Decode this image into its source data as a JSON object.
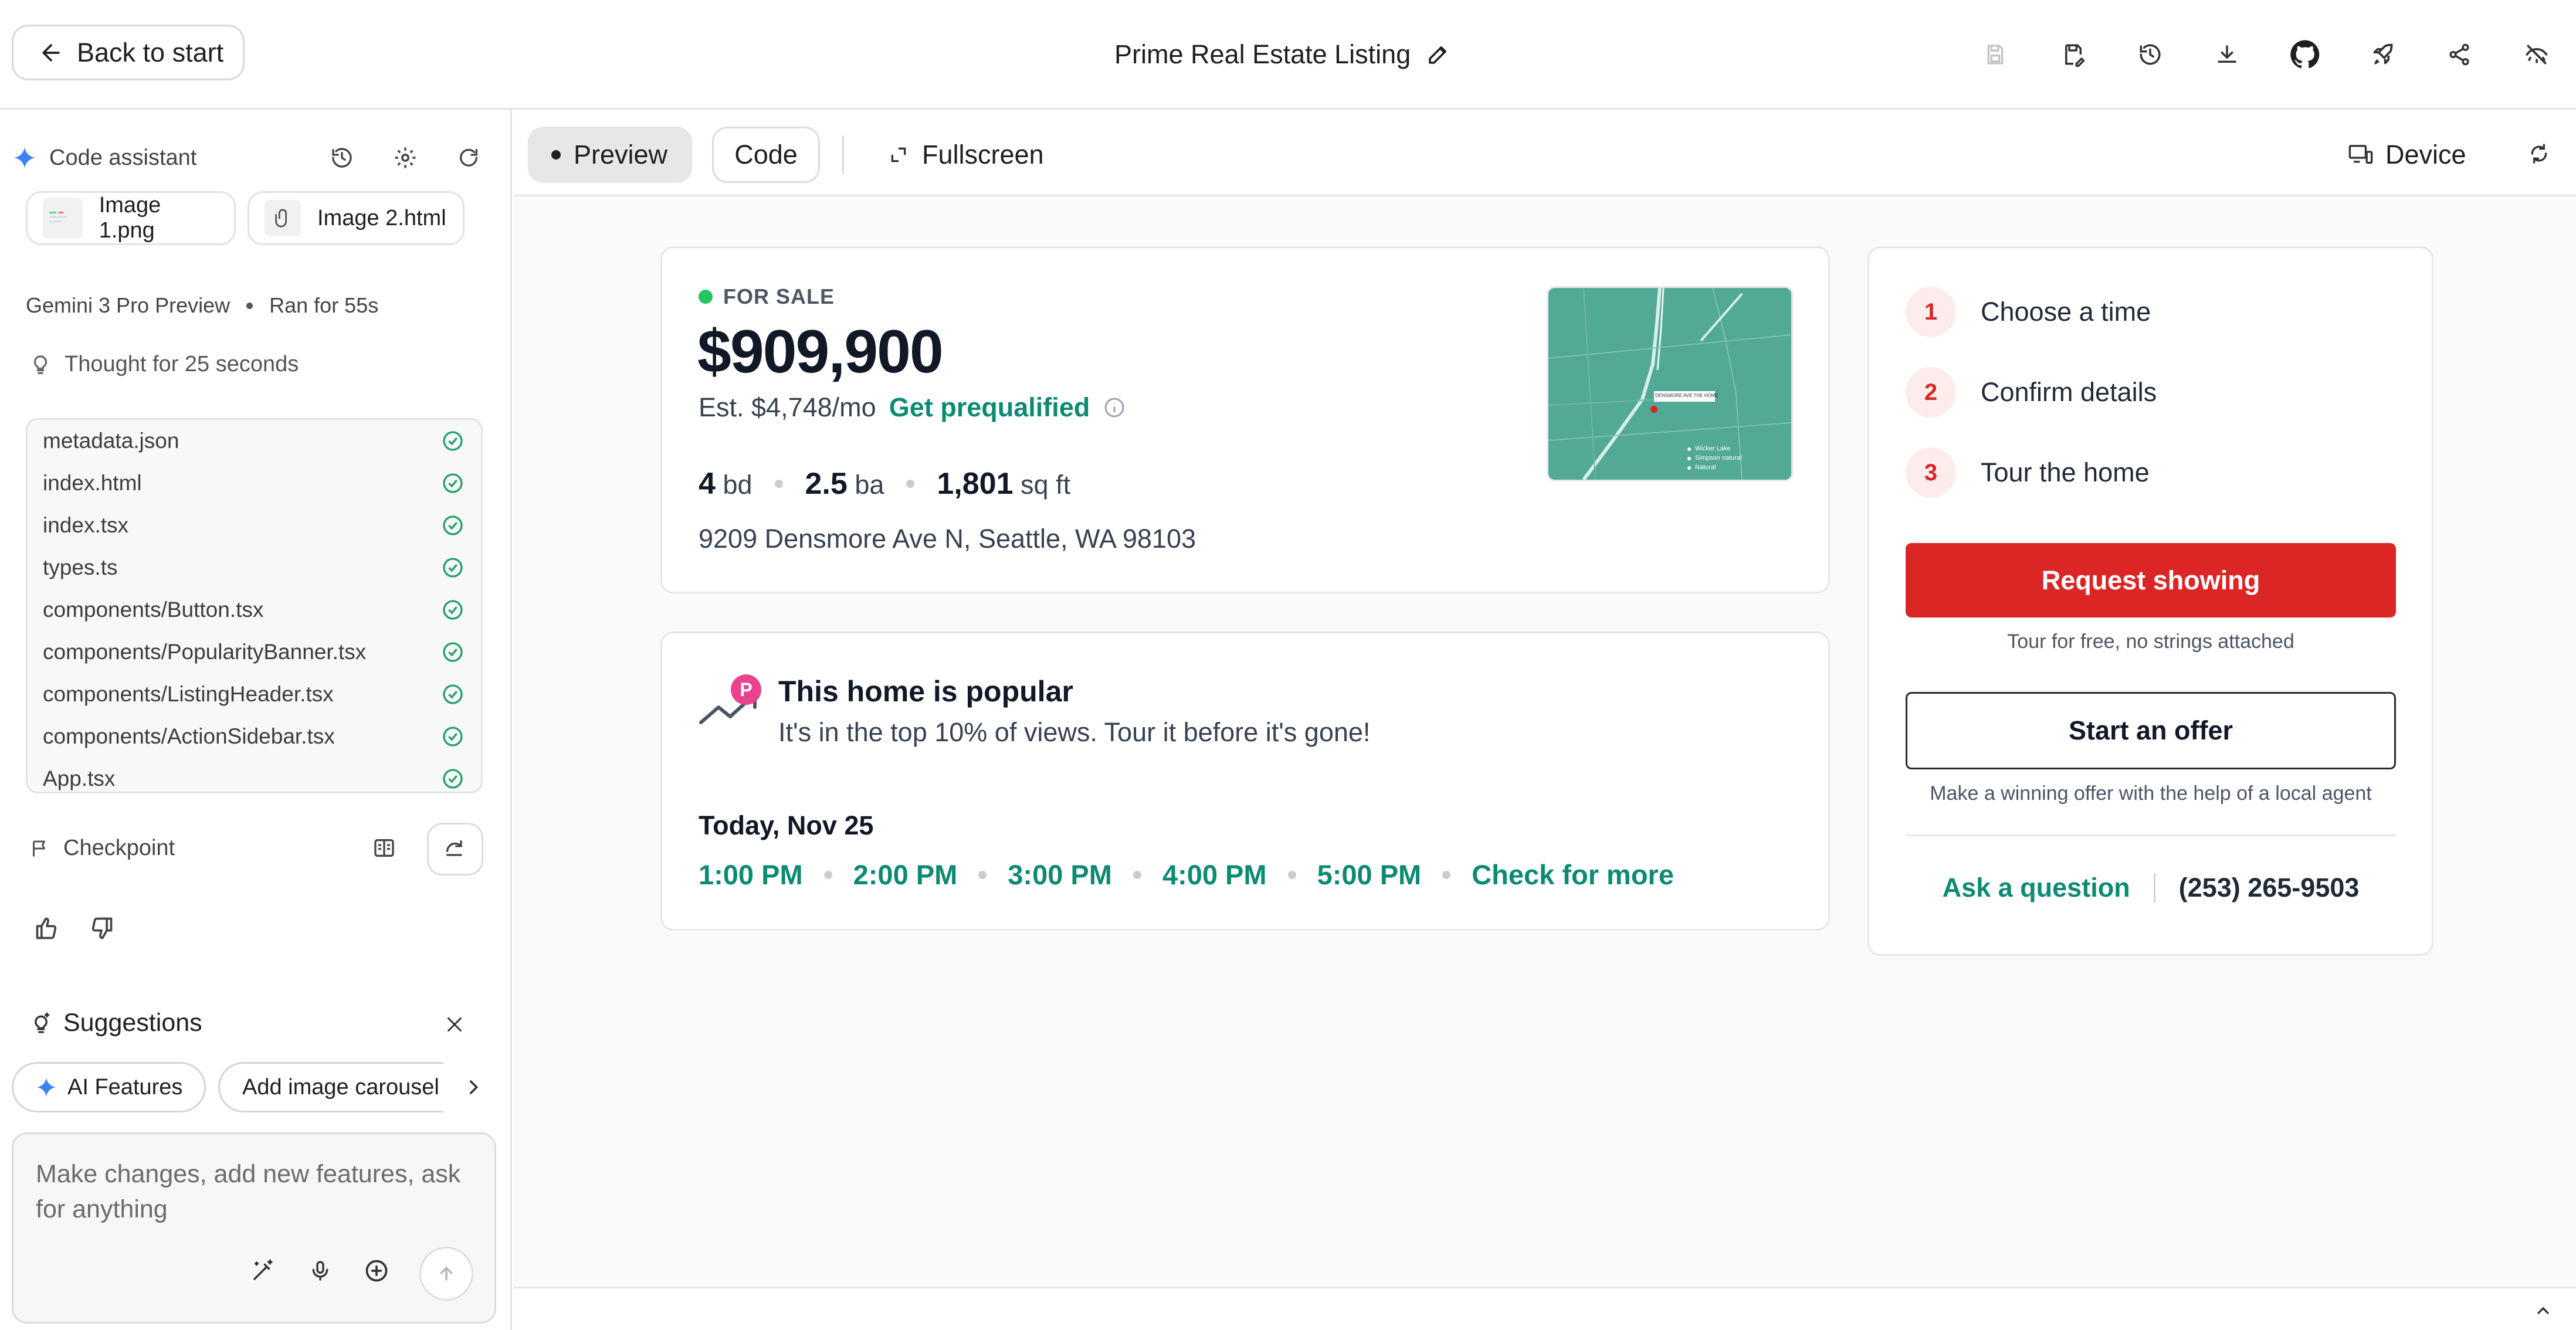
{
  "topbar": {
    "back_label": "Back to start",
    "project_title": "Prime Real Estate Listing",
    "icons": [
      "save-disabled-icon",
      "save-to-drive-icon",
      "history-icon",
      "download-icon",
      "github-icon",
      "deploy-rocket-icon",
      "share-icon",
      "hide-icon"
    ]
  },
  "sidebar": {
    "header_label": "Code assistant",
    "attachments": [
      {
        "name": "Image 1.png"
      },
      {
        "name": "Image 2.html"
      }
    ],
    "model": "Gemini 3 Pro Preview",
    "run_time": "Ran for 55s",
    "thought": "Thought for 25 seconds",
    "files": [
      "metadata.json",
      "index.html",
      "index.tsx",
      "types.ts",
      "components/Button.tsx",
      "components/PopularityBanner.tsx",
      "components/ListingHeader.tsx",
      "components/ActionSidebar.tsx",
      "App.tsx"
    ],
    "checkpoint_label": "Checkpoint",
    "suggestions_title": "Suggestions",
    "suggestions": [
      "AI Features",
      "Add image carousel"
    ],
    "composer_placeholder": "Make changes, add new features, ask for anything"
  },
  "viewbar": {
    "preview_label": "Preview",
    "code_label": "Code",
    "fullscreen_label": "Fullscreen",
    "device_label": "Device"
  },
  "listing": {
    "status": "FOR SALE",
    "price": "$909,900",
    "est_payment": "Est. $4,748/mo",
    "prequalify_link": "Get prequalified",
    "beds_value": "4",
    "beds_unit": "bd",
    "baths_value": "2.5",
    "baths_unit": "ba",
    "sqft_value": "1,801",
    "sqft_unit": "sq ft",
    "address": "9209 Densmore Ave N, Seattle, WA 98103",
    "map_marker_label": "DENSMORE AVE THE HOME",
    "map_legend": [
      "Wicker Lake",
      "Simpson natural",
      "Natural"
    ]
  },
  "popular": {
    "badge_letter": "P",
    "title": "This home is popular",
    "subtitle": "It's in the top 10% of views. Tour it before it's gone!",
    "date_label": "Today, Nov 25",
    "times": [
      "1:00 PM",
      "2:00 PM",
      "3:00 PM",
      "4:00 PM",
      "5:00 PM"
    ],
    "more_link": "Check for more"
  },
  "actions": {
    "steps": [
      {
        "num": "1",
        "label": "Choose a time"
      },
      {
        "num": "2",
        "label": "Confirm details"
      },
      {
        "num": "3",
        "label": "Tour the home"
      }
    ],
    "request_label": "Request showing",
    "request_note": "Tour for free, no strings attached",
    "offer_label": "Start an offer",
    "offer_note": "Make a winning offer with the help of a local agent",
    "ask_label": "Ask a question",
    "phone": "(253) 265-9503"
  },
  "colors": {
    "accent_green": "#0d8a74",
    "status_green": "#22c55e",
    "cta_red": "#dc2626",
    "map_teal": "#52a995",
    "badge_pink": "#e8438f"
  }
}
